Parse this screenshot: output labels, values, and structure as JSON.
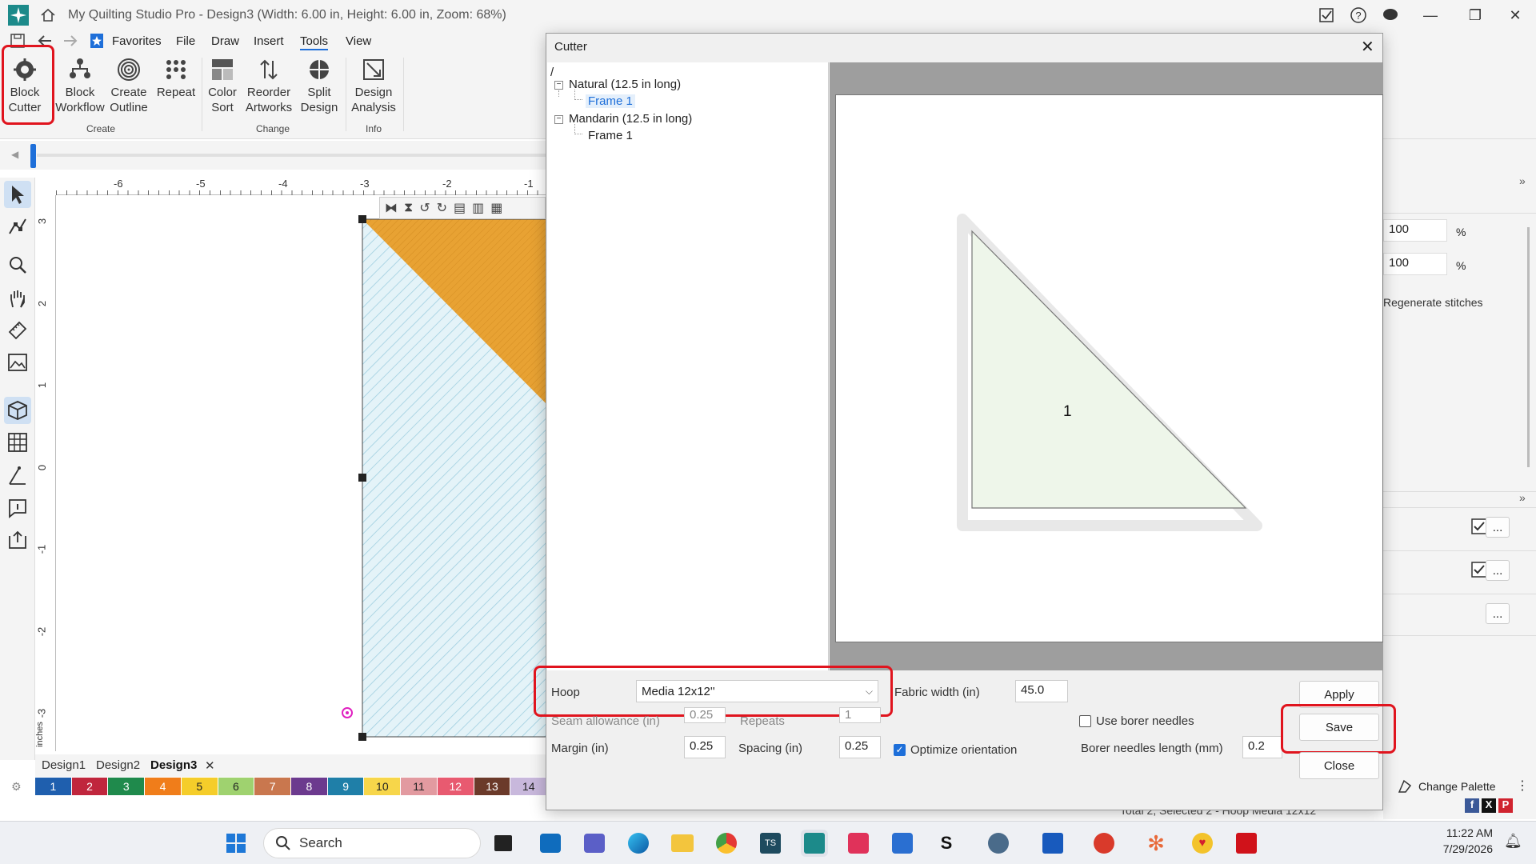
{
  "window": {
    "title": "My Quilting Studio Pro - Design3 (Width: 6.00 in, Height: 6.00 in, Zoom: 68%)"
  },
  "menu": {
    "items": [
      "Favorites",
      "File",
      "Draw",
      "Insert",
      "Tools",
      "View"
    ],
    "active": "Tools"
  },
  "ribbon": {
    "buttons": [
      {
        "line1": "Block",
        "line2": "Cutter",
        "icon": "block-cutter-icon"
      },
      {
        "line1": "Block",
        "line2": "Workflow",
        "icon": "block-workflow-icon"
      },
      {
        "line1": "Create",
        "line2": "Outline",
        "icon": "create-outline-icon"
      },
      {
        "line1": "Repeat",
        "line2": "",
        "icon": "repeat-icon"
      },
      {
        "line1": "Color",
        "line2": "Sort",
        "icon": "color-sort-icon"
      },
      {
        "line1": "Reorder",
        "line2": "Artworks",
        "icon": "reorder-icon"
      },
      {
        "line1": "Split",
        "line2": "Design",
        "icon": "split-design-icon"
      },
      {
        "line1": "Design",
        "line2": "Analysis",
        "icon": "design-analysis-icon"
      }
    ],
    "groups": [
      "Create",
      "Change",
      "Info"
    ]
  },
  "ruler": {
    "h_ticks": [
      "-6",
      "-5",
      "-4",
      "-3",
      "-2",
      "-1"
    ],
    "v_ticks": [
      "3",
      "2",
      "1",
      "0",
      "-1",
      "-2",
      "-3"
    ],
    "unit": "inches"
  },
  "dialog": {
    "title": "Cutter",
    "tree_root": "/",
    "tree": [
      {
        "label": "Natural (12.5 in long)",
        "children": [
          "Frame 1"
        ]
      },
      {
        "label": "Mandarin (12.5 in long)",
        "children": [
          "Frame 1"
        ]
      }
    ],
    "preview_piece_number": "1",
    "fields": {
      "hoop_label": "Hoop",
      "hoop_value": "Media 12x12''",
      "fabric_width_label": "Fabric width (in)",
      "fabric_width_value": "45.0",
      "seam_allowance_label": "Seam allowance (in)",
      "seam_allowance_value": "0.25",
      "repeats_label": "Repeats",
      "repeats_value": "1",
      "margin_label": "Margin (in)",
      "margin_value": "0.25",
      "spacing_label": "Spacing (in)",
      "spacing_value": "0.25",
      "optimize_label": "Optimize orientation",
      "optimize_checked": true,
      "borer_label": "Use borer needles",
      "borer_checked": false,
      "borer_length_label": "Borer needles length (mm)",
      "borer_length_value": "0.2"
    },
    "buttons": {
      "apply": "Apply",
      "save": "Save",
      "close": "Close"
    }
  },
  "doc_tabs": [
    "Design1",
    "Design2",
    "Design3"
  ],
  "palette": [
    {
      "n": "1",
      "c": "#1f5fae"
    },
    {
      "n": "2",
      "c": "#c0263d"
    },
    {
      "n": "3",
      "c": "#1f8a4c"
    },
    {
      "n": "4",
      "c": "#f07d1a"
    },
    {
      "n": "5",
      "c": "#f5cd2a"
    },
    {
      "n": "6",
      "c": "#9fd26f"
    },
    {
      "n": "7",
      "c": "#c9774e"
    },
    {
      "n": "8",
      "c": "#6c3a8e"
    },
    {
      "n": "9",
      "c": "#1f7fa8"
    },
    {
      "n": "10",
      "c": "#f7d64a"
    },
    {
      "n": "11",
      "c": "#e29aa0"
    },
    {
      "n": "12",
      "c": "#e85a70"
    },
    {
      "n": "13",
      "c": "#6b3a2a"
    },
    {
      "n": "14",
      "c": "#c8b8dc"
    }
  ],
  "right_panel": {
    "scale_x": "100",
    "scale_y": "100",
    "percent": "%",
    "regenerate": "Regenerate stitches",
    "more": "...",
    "change_palette": "Change Palette",
    "status": "Total 2, Selected 2 - Hoop Media 12x12"
  },
  "taskbar": {
    "search_placeholder": "Search",
    "time": "11:22 AM",
    "date": "7/29/2026"
  }
}
